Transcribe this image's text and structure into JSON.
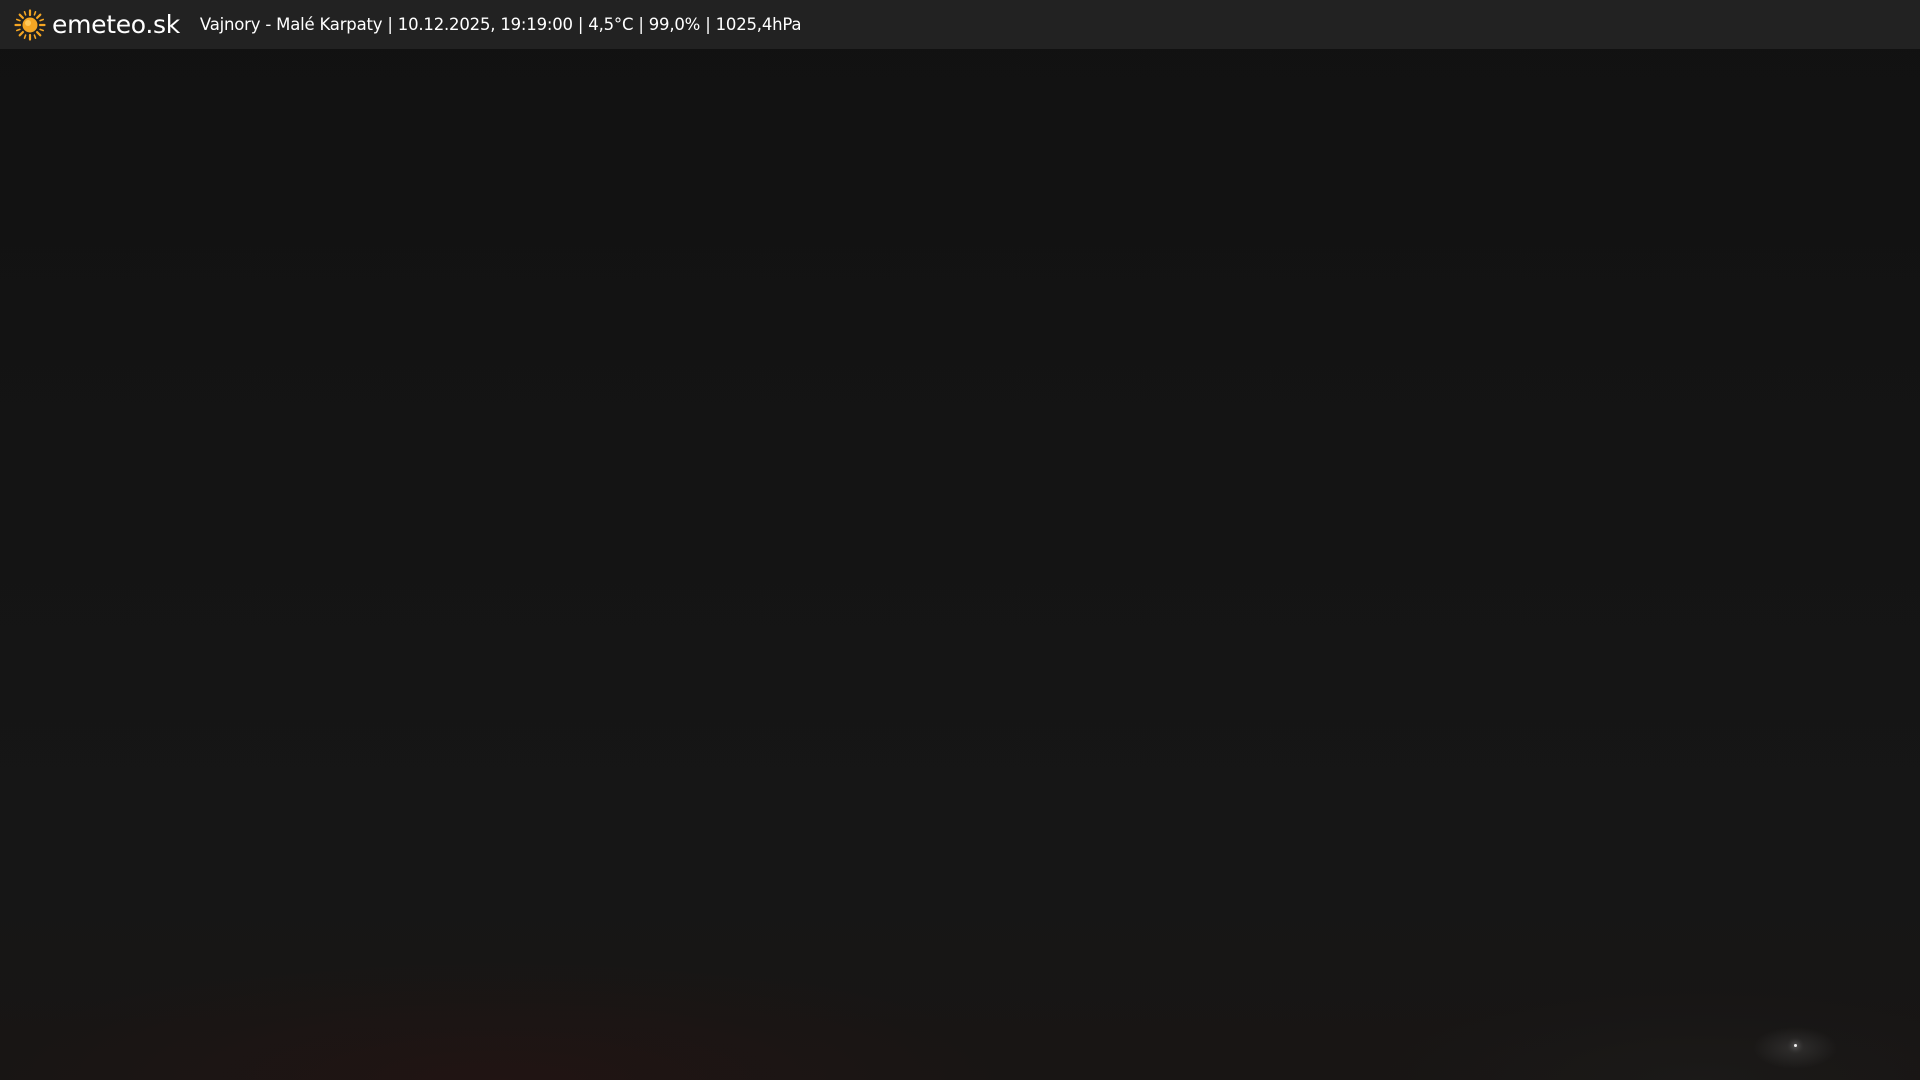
{
  "header": {
    "logo_icon": "sun-icon",
    "brand": "emeteo.sk",
    "station_info": "Vajnory - Malé Karpaty | 10.12.2025, 19:19:00 | 4,5°C | 99,0% | 1025,4hPa"
  },
  "colors": {
    "header_background": "#222222",
    "sun_icon": "#f5a623",
    "text": "#ffffff"
  }
}
